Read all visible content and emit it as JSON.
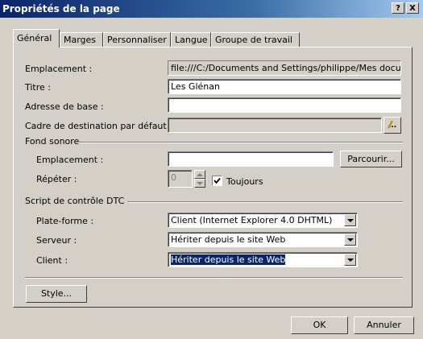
{
  "window": {
    "title": "Propriétés de la page",
    "help_button": "?",
    "close_button": "X"
  },
  "tabs": [
    {
      "label": "Général"
    },
    {
      "label": "Marges"
    },
    {
      "label": "Personnaliser"
    },
    {
      "label": "Langue"
    },
    {
      "label": "Groupe de travail"
    }
  ],
  "general": {
    "emplacement_label": "Emplacement :",
    "emplacement_value": "file:///C:/Documents and Settings/philippe/Mes document",
    "titre_label": "Titre :",
    "titre_value": "Les Glénan",
    "adresse_label": "Adresse de base :",
    "adresse_value": "",
    "cadre_label": "Cadre de destination par défaut :",
    "cadre_value": "",
    "cadre_button": "..."
  },
  "fond_sonore": {
    "legend": "Fond sonore",
    "emplacement_label": "Emplacement :",
    "emplacement_value": "",
    "parcourir_button": "Parcourir...",
    "repeter_label": "Répéter :",
    "repeter_value": "0",
    "toujours_label": "Toujours",
    "toujours_checked": true
  },
  "script_dtc": {
    "legend": "Script de contrôle DTC",
    "plateforme_label": "Plate-forme :",
    "plateforme_value": "Client (Internet Explorer 4.0 DHTML)",
    "serveur_label": "Serveur :",
    "serveur_value": "Hériter depuis le site Web",
    "client_label": "Client :",
    "client_value": "Hériter depuis le site Web"
  },
  "style_button": "Style...",
  "ok_button": "OK",
  "cancel_button": "Annuler"
}
